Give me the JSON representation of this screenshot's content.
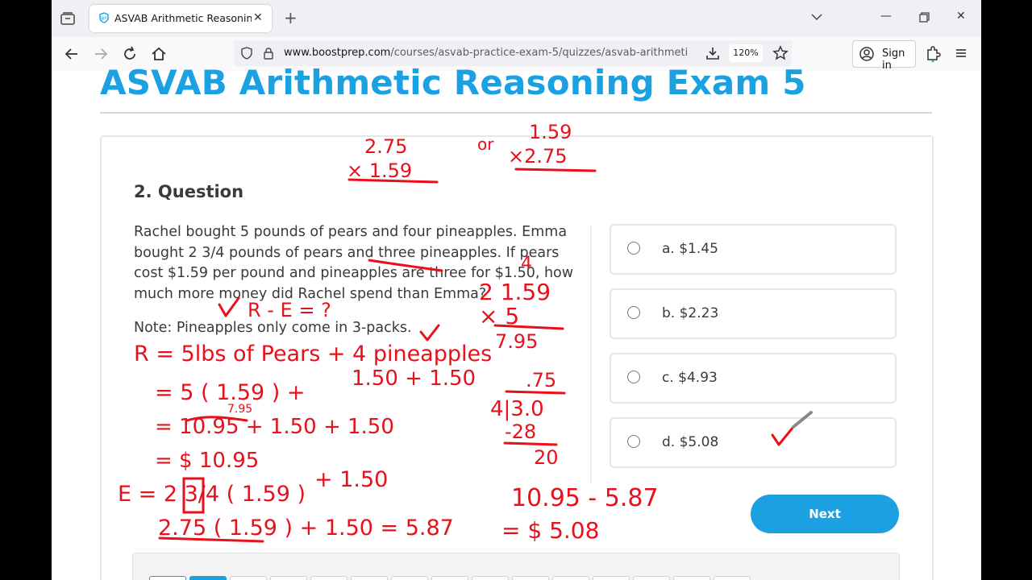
{
  "browser": {
    "tab_title": "ASVAB Arithmetic Reasoning Exam 5",
    "url_host": "www.boostprep.com",
    "url_path": "/courses/asvab-practice-exam-5/quizzes/asvab-arithmetic-rea",
    "zoom": "120%",
    "sign_in": "Sign in"
  },
  "page": {
    "heading": "ASVAB Arithmetic Reasoning Exam 5",
    "question_title": "2. Question",
    "question_text": "Rachel bought 5 pounds of pears and four pineapples. Emma bought 2 3/4 pounds of pears and three pineapples. If pears cost $1.59 per pound and pineapples are three for $1.50, how much more money did Rachel spend than Emma?",
    "note": "Note: Pineapples only come in 3-packs.",
    "options": [
      {
        "label": "a. $1.45"
      },
      {
        "label": "b. $2.23"
      },
      {
        "label": "c. $4.93"
      },
      {
        "label": "d. $5.08"
      }
    ],
    "next_label": "Next"
  },
  "annotations": {
    "top_left": "2.75",
    "top_left2": "× 1.59",
    "or": "or",
    "top_right": "1.59",
    "top_right2": "×2.75",
    "r_minus_e": "R - E = ?",
    "r_line1": "R = 5lbs of Pears + 4 pineapples",
    "r_line2": "= 5 ( 1.59 ) +",
    "r_line2b": "1.50 + 1.50",
    "r_line3_small": "7.95",
    "r_line3": "= 10.95 + 1.50 + 1.50",
    "r_line4": "= $ 10.95",
    "e_line1": "E = 2 3/4 ( 1.59 )",
    "e_line1b": "+ 1.50",
    "e_line2": "2.75 ( 1.59 ) + 1.50 = 5.87",
    "calc_top": "4",
    "calc1": "2 1.59",
    "calc2": "× 5",
    "calc3": "7.95",
    "div_q": ".75",
    "div_l": "4|3.0",
    "div_s": "-28",
    "div_r": "20",
    "final1": "10.95 - 5.87",
    "final2": "= $ 5.08"
  }
}
